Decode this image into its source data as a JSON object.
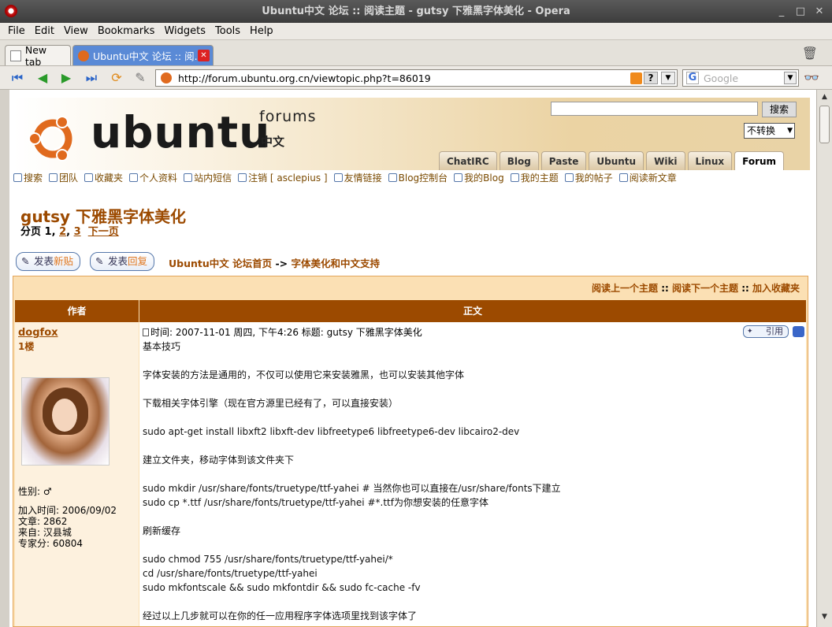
{
  "window": {
    "title": "Ubuntu中文 论坛 :: 阅读主题 - gutsy 下雅黑字体美化 - Opera"
  },
  "menu": [
    "File",
    "Edit",
    "View",
    "Bookmarks",
    "Widgets",
    "Tools",
    "Help"
  ],
  "tabs": {
    "new_tab": "New tab",
    "active_tab": "Ubuntu中文 论坛 :: 阅..."
  },
  "address": {
    "url": "http://forum.ubuntu.org.cn/viewtopic.php?t=86019"
  },
  "search": {
    "placeholder": "Google"
  },
  "header": {
    "logo": "ubuntu",
    "forums": "forums",
    "zh": "中文",
    "search_button": "搜索",
    "convert_select": "不转换",
    "nav_tabs": [
      "ChatIRC",
      "Blog",
      "Paste",
      "Ubuntu",
      "Wiki",
      "Linux",
      "Forum"
    ]
  },
  "links": [
    "搜索",
    "团队",
    "收藏夹",
    "个人资料",
    "站内短信",
    "注销 [ asclepius ]",
    "友情链接",
    "Blog控制台",
    "我的Blog",
    "我的主题",
    "我的帖子",
    "阅读新文章"
  ],
  "page": {
    "title": "gutsy 下雅黑字体美化",
    "pager_label": "分页",
    "pager_current": "1,",
    "pager_p2": "2",
    "pager_comma": ",",
    "pager_p3": "3",
    "pager_next": "下一页",
    "new_post": {
      "a": "发表",
      "b": "新贴"
    },
    "reply": {
      "a": "发表",
      "b": "回复"
    },
    "breadcrumb_home": "Ubuntu中文 论坛首页",
    "breadcrumb_arrow": "->",
    "breadcrumb_cat": "字体美化和中文支持"
  },
  "table": {
    "nav_prev": "阅读上一个主题",
    "nav_sep": "::",
    "nav_next": "阅读下一个主题",
    "nav_fav": "加入收藏夹",
    "col_author": "作者",
    "col_body": "正文"
  },
  "post": {
    "author": "dogfox",
    "floor": "1楼",
    "gender": "性别: ♂",
    "joined": "加入时间: 2006/09/02",
    "posts": "文章: 2862",
    "from": "来自: 汉县城",
    "score": "专家分: 60804",
    "header": "时间: 2007-11-01 周四, 下午4:26     标题: gutsy 下雅黑字体美化",
    "quote": "引用",
    "lines": [
      "基本技巧",
      "",
      "字体安装的方法是通用的，不仅可以使用它来安装雅黑，也可以安装其他字体",
      "",
      "下载相关字体引擎（现在官方源里已经有了，可以直接安装）",
      "",
      "sudo apt-get install libxft2 libxft-dev libfreetype6 libfreetype6-dev libcairo2-dev",
      "",
      "建立文件夹，移动字体到该文件夹下",
      "",
      "sudo mkdir /usr/share/fonts/truetype/ttf-yahei # 当然你也可以直接在/usr/share/fonts下建立",
      "sudo cp *.ttf /usr/share/fonts/truetype/ttf-yahei #*.ttf为你想安装的任意字体",
      "",
      "刷新缓存",
      "",
      "sudo chmod 755 /usr/share/fonts/truetype/ttf-yahei/*",
      "cd /usr/share/fonts/truetype/ttf-yahei",
      "sudo mkfontscale && sudo mkfontdir && sudo fc-cache -fv",
      "",
      "经过以上几步就可以在你的任一应用程序字体选项里找到该字体了"
    ]
  }
}
